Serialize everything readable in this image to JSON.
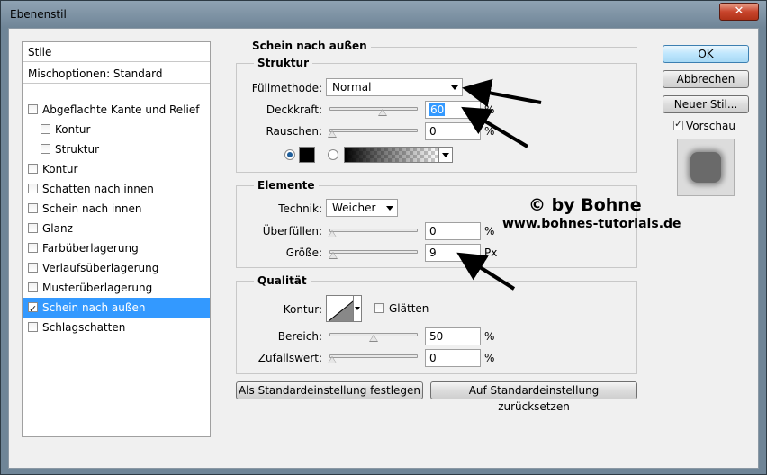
{
  "window": {
    "title": "Ebenenstil"
  },
  "stylelist": {
    "header": "Stile",
    "blend": "Mischoptionen: Standard",
    "items": [
      {
        "label": "Abgeflachte Kante und Relief",
        "checked": false,
        "indent": 0
      },
      {
        "label": "Kontur",
        "checked": false,
        "indent": 1
      },
      {
        "label": "Struktur",
        "checked": false,
        "indent": 1
      },
      {
        "label": "Kontur",
        "checked": false,
        "indent": 0
      },
      {
        "label": "Schatten nach innen",
        "checked": false,
        "indent": 0
      },
      {
        "label": "Schein nach innen",
        "checked": false,
        "indent": 0
      },
      {
        "label": "Glanz",
        "checked": false,
        "indent": 0
      },
      {
        "label": "Farbüberlagerung",
        "checked": false,
        "indent": 0
      },
      {
        "label": "Verlaufsüberlagerung",
        "checked": false,
        "indent": 0
      },
      {
        "label": "Musterüberlagerung",
        "checked": false,
        "indent": 0
      },
      {
        "label": "Schein nach außen",
        "checked": true,
        "indent": 0,
        "selected": true
      },
      {
        "label": "Schlagschatten",
        "checked": false,
        "indent": 0
      }
    ]
  },
  "panel": {
    "title": "Schein nach außen",
    "struktur": {
      "title": "Struktur",
      "blendmode_label": "Füllmethode:",
      "blendmode_value": "Normal",
      "opacity_label": "Deckkraft:",
      "opacity_value": "60",
      "opacity_unit": "%",
      "opacity_level": 60,
      "noise_label": "Rauschen:",
      "noise_value": "0",
      "noise_unit": "%",
      "noise_level": 0
    },
    "elemente": {
      "title": "Elemente",
      "technique_label": "Technik:",
      "technique_value": "Weicher",
      "spread_label": "Überfüllen:",
      "spread_value": "0",
      "spread_unit": "%",
      "spread_level": 0,
      "size_label": "Größe:",
      "size_value": "9",
      "size_unit": "Px",
      "size_level": 9
    },
    "qualitaet": {
      "title": "Qualität",
      "contour_label": "Kontur:",
      "antialias_label": "Glätten",
      "range_label": "Bereich:",
      "range_value": "50",
      "range_unit": "%",
      "range_level": 50,
      "jitter_label": "Zufallswert:",
      "jitter_value": "0",
      "jitter_unit": "%",
      "jitter_level": 0
    },
    "make_default": "Als Standardeinstellung festlegen",
    "reset_default": "Auf Standardeinstellung zurücksetzen"
  },
  "buttons": {
    "ok": "OK",
    "cancel": "Abbrechen",
    "new_style": "Neuer Stil...",
    "preview_label": "Vorschau"
  },
  "watermark": {
    "line1": "© by Bohne",
    "line2": "www.bohnes-tutorials.de"
  },
  "colors": {
    "selection": "#3399ff",
    "glow_color": "#000000"
  }
}
